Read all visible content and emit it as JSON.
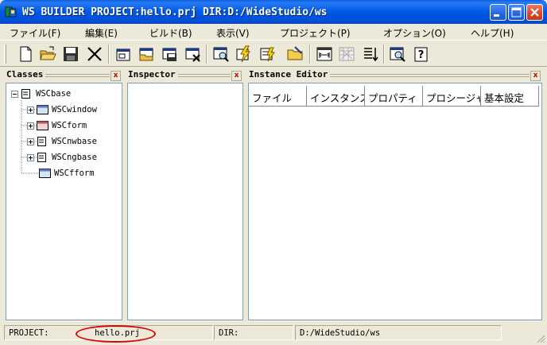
{
  "window": {
    "title": "WS BUILDER PROJECT:hello.prj DIR:D:/WideStudio/ws",
    "icon": "widestudio-app-icon"
  },
  "menu": [
    {
      "label": "ファイル(F)"
    },
    {
      "label": "編集(E)"
    },
    {
      "label": "ビルド(B)"
    },
    {
      "label": "表示(V)"
    },
    {
      "label": "プロジェクト(P)"
    },
    {
      "label": "オプション(O)"
    },
    {
      "label": "ヘルプ(H)"
    }
  ],
  "toolbar_icons": [
    "new-file-icon",
    "open-folder-icon",
    "save-disk-icon",
    "cut-icon",
    "new-window-icon",
    "open-window-icon",
    "save-window-icon",
    "close-window-icon",
    "search-window-icon",
    "build-lightning-icon",
    "build-run-icon",
    "folder-icon",
    "align-grid-icon",
    "disabled-grid-icon",
    "sort-icon",
    "preview-icon",
    "help-icon"
  ],
  "panels": {
    "classes": {
      "title": "Classes",
      "close": "x"
    },
    "inspector": {
      "title": "Inspector",
      "close": "x"
    },
    "instance_editor": {
      "title": "Instance Editor",
      "close": "x"
    }
  },
  "tree": [
    {
      "label": "WSCbase"
    },
    {
      "label": "WSCwindow"
    },
    {
      "label": "WSCform"
    },
    {
      "label": "WSCnwbase"
    },
    {
      "label": "WSCngbase"
    },
    {
      "label": "WSCfform"
    }
  ],
  "instance_tabs": [
    {
      "label": "ファイル"
    },
    {
      "label": "インスタンス"
    },
    {
      "label": "プロパティ"
    },
    {
      "label": "プロシージャ"
    },
    {
      "label": "基本設定"
    }
  ],
  "status": {
    "project_label": "PROJECT:",
    "project_value": "hello.prj",
    "dir_label": "DIR:",
    "dir_value": "D:/WideStudio/ws"
  },
  "colors": {
    "titlebar": "#0058e6",
    "highlight": "#e00000"
  }
}
